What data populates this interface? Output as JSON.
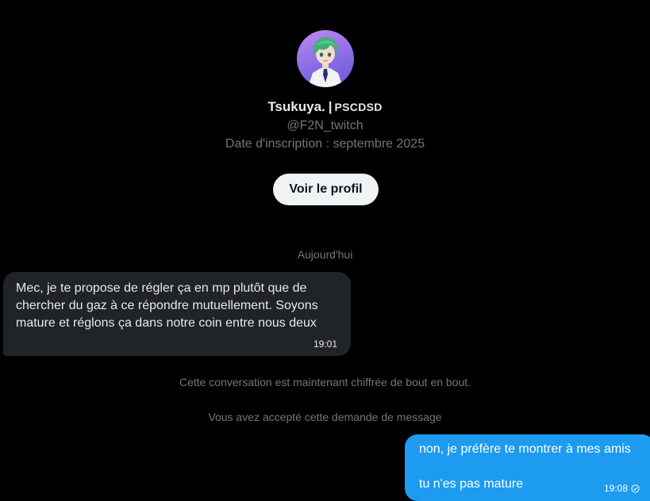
{
  "profile": {
    "display_name": "Tsukuya.",
    "separator": "|",
    "tag": "PSCDSD",
    "handle": "@F2N_twitch",
    "joined": "Date d'inscription : septembre 2025",
    "view_profile_label": "Voir le profil",
    "avatar_icon": "anime-avatar-icon"
  },
  "conversation": {
    "date_divider": "Aujourd'hui",
    "messages": [
      {
        "direction": "incoming",
        "text": "Mec, je te propose de régler ça en mp plutôt que de chercher du gaz à ce répondre mutuellement. Soyons mature et réglons ça dans notre coin entre nous deux",
        "time": "19:01"
      },
      {
        "direction": "outgoing",
        "lines": [
          "non, je préfère te montrer à mes amis",
          "tu n'es pas mature"
        ],
        "time": "19:08",
        "status_icon": "sent-check-icon"
      }
    ],
    "system_messages": [
      "Cette conversation est maintenant chiffrée de bout en bout.",
      "Vous avez accepté cette demande de message"
    ]
  },
  "colors": {
    "background": "#000000",
    "incoming_bubble": "#202327",
    "outgoing_bubble": "#1d9bf0",
    "muted_text": "#71767b",
    "button_bg": "#eff3f4"
  }
}
